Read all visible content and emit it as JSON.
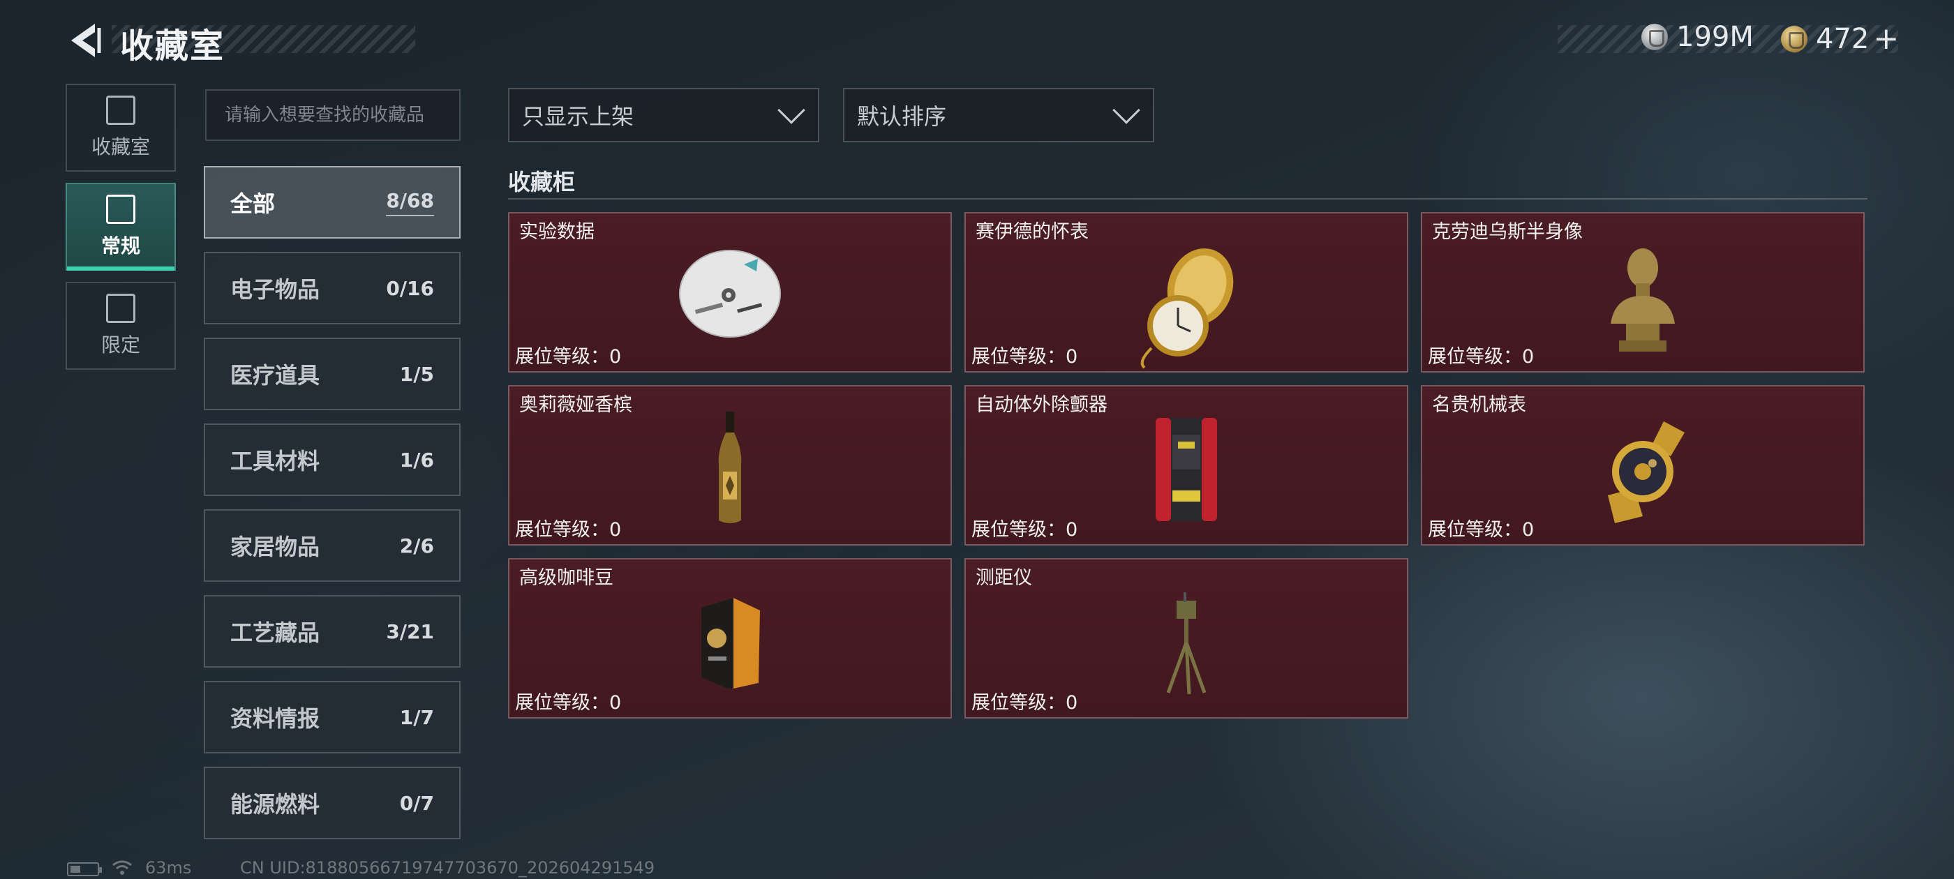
{
  "header": {
    "title": "收藏室",
    "currency_silver": "199M",
    "currency_gold": "472"
  },
  "side_tabs": [
    {
      "label": "收藏室"
    },
    {
      "label": "常规"
    },
    {
      "label": "限定"
    }
  ],
  "search": {
    "placeholder": "请输入想要查找的收藏品"
  },
  "categories": [
    {
      "name": "全部",
      "count": "8/68"
    },
    {
      "name": "电子物品",
      "count": "0/16"
    },
    {
      "name": "医疗道具",
      "count": "1/5"
    },
    {
      "name": "工具材料",
      "count": "1/6"
    },
    {
      "name": "家居物品",
      "count": "2/6"
    },
    {
      "name": "工艺藏品",
      "count": "3/21"
    },
    {
      "name": "资料情报",
      "count": "1/7"
    },
    {
      "name": "能源燃料",
      "count": "0/7"
    }
  ],
  "filters": {
    "show": "只显示上架",
    "sort": "默认排序"
  },
  "section": {
    "title": "收藏柜"
  },
  "items": [
    {
      "name": "实验数据",
      "level": "展位等级：0",
      "icon": "disc-icon"
    },
    {
      "name": "赛伊德的怀表",
      "level": "展位等级：0",
      "icon": "pocket-watch-icon"
    },
    {
      "name": "克劳迪乌斯半身像",
      "level": "展位等级：0",
      "icon": "bust-icon"
    },
    {
      "name": "奥莉薇娅香槟",
      "level": "展位等级：0",
      "icon": "champagne-icon"
    },
    {
      "name": "自动体外除颤器",
      "level": "展位等级：0",
      "icon": "defibrillator-icon"
    },
    {
      "name": "名贵机械表",
      "level": "展位等级：0",
      "icon": "wristwatch-icon"
    },
    {
      "name": "高级咖啡豆",
      "level": "展位等级：0",
      "icon": "coffee-bag-icon"
    },
    {
      "name": "测距仪",
      "level": "展位等级：0",
      "icon": "rangefinder-icon"
    }
  ],
  "status": {
    "ping": "63ms",
    "uid": "CN UID:81880566719747703670_202604291549"
  },
  "colors": {
    "card_bg": "#4a1c24",
    "accent": "#3fd0b0"
  }
}
